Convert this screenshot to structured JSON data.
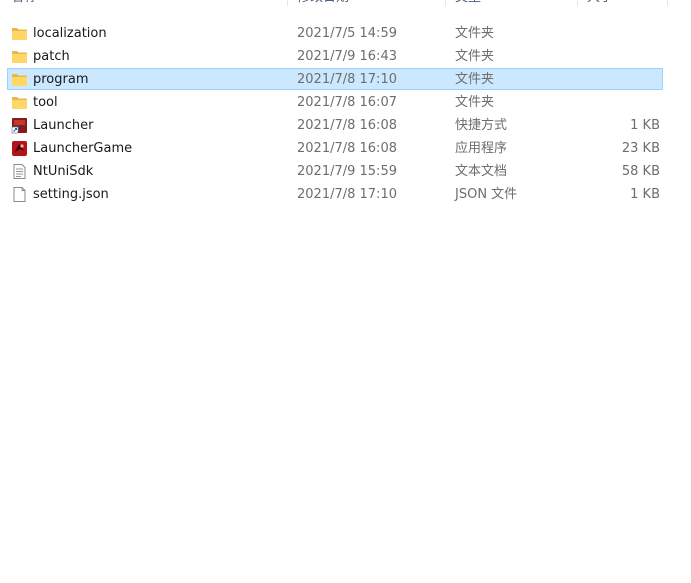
{
  "columns": {
    "name": "名称",
    "date": "修改日期",
    "type": "类型",
    "size": "大小"
  },
  "files": [
    {
      "name": "localization",
      "date": "2021/7/5 14:59",
      "type": "文件夹",
      "size": "",
      "icon": "folder-icon"
    },
    {
      "name": "patch",
      "date": "2021/7/9 16:43",
      "type": "文件夹",
      "size": "",
      "icon": "folder-icon"
    },
    {
      "name": "program",
      "date": "2021/7/8 17:10",
      "type": "文件夹",
      "size": "",
      "icon": "folder-icon",
      "selected": true
    },
    {
      "name": "tool",
      "date": "2021/7/8 16:07",
      "type": "文件夹",
      "size": "",
      "icon": "folder-icon"
    },
    {
      "name": "Launcher",
      "date": "2021/7/8 16:08",
      "type": "快捷方式",
      "size": "1 KB",
      "icon": "shortcut-app-icon"
    },
    {
      "name": "LauncherGame",
      "date": "2021/7/8 16:08",
      "type": "应用程序",
      "size": "23 KB",
      "icon": "app-icon"
    },
    {
      "name": "NtUniSdk",
      "date": "2021/7/9 15:59",
      "type": "文本文档",
      "size": "58 KB",
      "icon": "text-document-icon"
    },
    {
      "name": "setting.json",
      "date": "2021/7/8 17:10",
      "type": "JSON 文件",
      "size": "1 KB",
      "icon": "blank-file-icon"
    }
  ],
  "colors": {
    "selection_fill": "#cce8ff",
    "selection_border": "#99d1ff",
    "folder": "#ffd766",
    "header_text": "#4c607a",
    "secondary_text": "#6d6d6d"
  }
}
